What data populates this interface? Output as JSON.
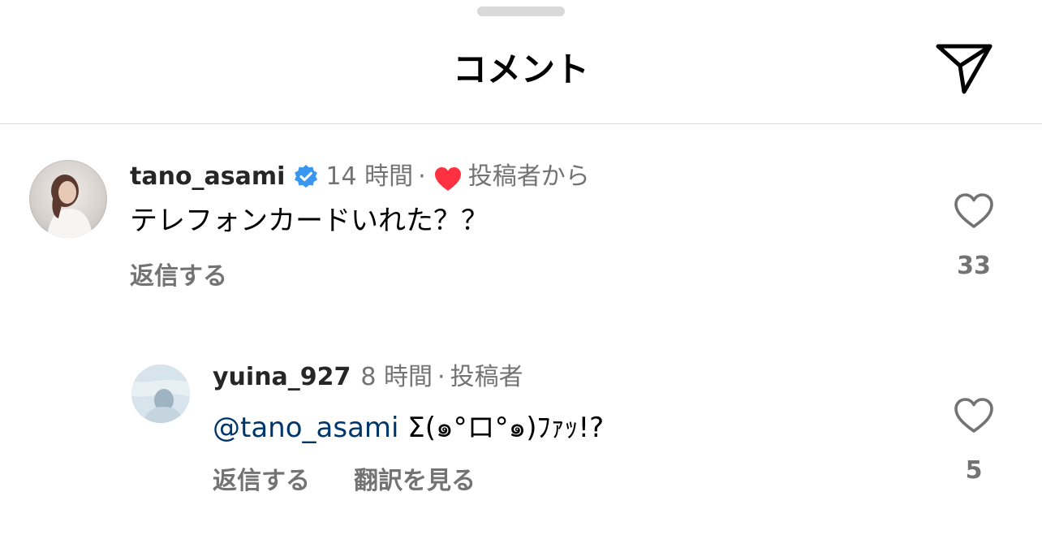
{
  "header": {
    "title": "コメント",
    "share_icon": "paper-plane-icon"
  },
  "comments": [
    {
      "username": "tano_asami",
      "verified": true,
      "time": "14 時間",
      "separator": "·",
      "liked_by_author_icon": "red-heart-icon",
      "liked_by_author_label": "投稿者から",
      "text": "テレフォンカードいれた？？",
      "reply_label": "返信する",
      "like_icon": "heart-outline-icon",
      "like_count": "33"
    },
    {
      "username": "yuina_927",
      "time": "8 時間",
      "separator": "·",
      "author_label": "投稿者",
      "mention": "@tano_asami",
      "text": "Σ(๑°ロ°๑)ﾌｧｯ!?",
      "reply_label": "返信する",
      "translate_label": "翻訳を見る",
      "like_icon": "heart-outline-icon",
      "like_count": "5"
    }
  ],
  "colors": {
    "text": "#000000",
    "secondary": "#737373",
    "mention": "#00376b",
    "verified": "#3897f0",
    "heart_red": "#ff3040",
    "divider": "#dbdbdb"
  }
}
